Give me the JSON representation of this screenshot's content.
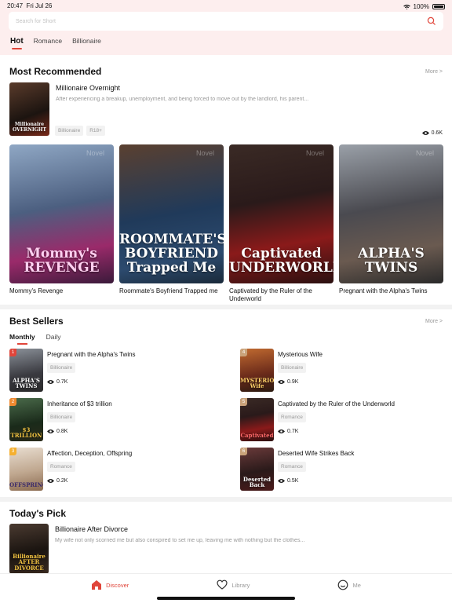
{
  "status": {
    "time": "20:47",
    "date": "Fri Jul 26",
    "battery": "100%"
  },
  "search": {
    "placeholder": "Search for Short"
  },
  "tabs": [
    "Hot",
    "Romance",
    "Billionaire"
  ],
  "recommended": {
    "title": "Most Recommended",
    "more": "More >",
    "featured": {
      "title": "Millionaire Overnight",
      "description": "After experiencing a breakup, unemployment, and being forced to move out by the landlord, his parent...",
      "tags": [
        "Billionaire",
        "R18+"
      ],
      "views": "0.6K",
      "cover_text": "Millionaire OVERNIGHT"
    },
    "cards": [
      {
        "title": "Mommy's Revenge",
        "cover_text": "Mommy's REVENGE"
      },
      {
        "title": "Roommate's Boyfriend Trapped me",
        "cover_text": "ROOMMATE'S BOYFRIEND Trapped Me"
      },
      {
        "title": "Captivated by the Ruler of the Underworld",
        "cover_text": "Captivated UNDERWORLD"
      },
      {
        "title": "Pregnant with the Alpha's Twins",
        "cover_text": "ALPHA'S TWINS"
      }
    ]
  },
  "bestsellers": {
    "title": "Best Sellers",
    "more": "More >",
    "tabs": [
      "Monthly",
      "Daily"
    ],
    "items": [
      {
        "rank": "1",
        "title": "Pregnant with the Alpha's Twins",
        "tag": "Billionaire",
        "views": "0.7K",
        "cover_text": "ALPHA'S TWINS"
      },
      {
        "rank": "4",
        "title": "Mysterious Wife",
        "tag": "Billionaire",
        "views": "0.9K",
        "cover_text": "MYSTERIOUS Wife"
      },
      {
        "rank": "2",
        "title": "Inheritance of $3 trillion",
        "tag": "Billionaire",
        "views": "0.8K",
        "cover_text": "$3 TRILLION"
      },
      {
        "rank": "5",
        "title": "Captivated by the Ruler of the Underworld",
        "tag": "Romance",
        "views": "0.7K",
        "cover_text": "Captivated"
      },
      {
        "rank": "3",
        "title": "Affection, Deception, Offspring",
        "tag": "Romance",
        "views": "0.2K",
        "cover_text": "OFFSPRING"
      },
      {
        "rank": "6",
        "title": "Deserted Wife Strikes Back",
        "tag": "Romance",
        "views": "0.5K",
        "cover_text": "Deserted Back"
      }
    ]
  },
  "pick": {
    "title": "Today's Pick",
    "item": {
      "title": "Billionaire After Divorce",
      "description": "My wife not only scorned me but also conspired to set me up, leaving me with nothing but the clothes...",
      "cover_text": "Billionaire AFTER DIVORCE"
    }
  },
  "nav": [
    "Discover",
    "Library",
    "Me"
  ],
  "colors": {
    "accent": "#e0453a",
    "top_bg": "#fdeeee"
  }
}
